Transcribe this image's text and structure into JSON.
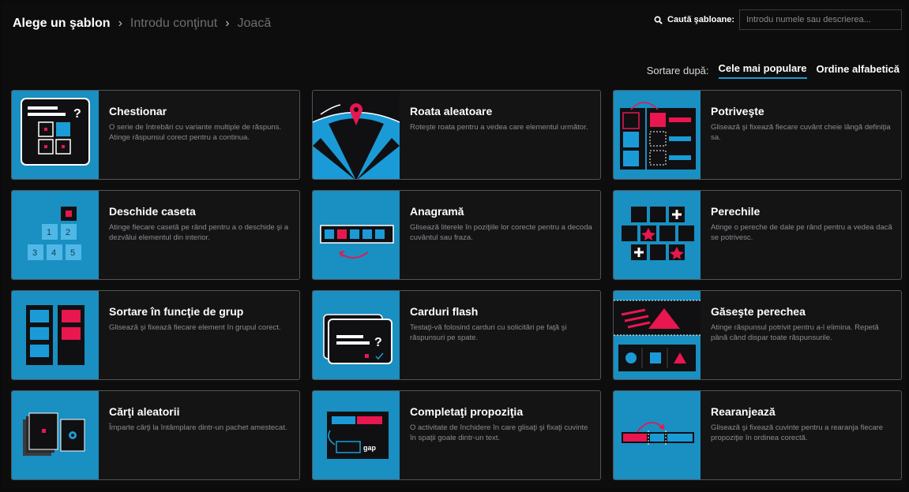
{
  "breadcrumb": {
    "step1": "Alege un şablon",
    "step2": "Introdu conţinut",
    "step3": "Joacă",
    "separator": "›"
  },
  "search": {
    "label": "Caută şabloane:",
    "placeholder": "Introdu numele sau descrierea..."
  },
  "sort": {
    "label": "Sortare după:",
    "options": [
      "Cele mai populare",
      "Ordine alfabetică"
    ],
    "active": "Cele mai populare"
  },
  "colors": {
    "accent_blue": "#1a9bd7",
    "thumb_blue": "#1a8fc1",
    "accent_pink": "#e8174f"
  },
  "templates": [
    {
      "title": "Chestionar",
      "description": "O serie de întrebări cu variante multiple de răspuns. Atinge răspunsul corect pentru a continua.",
      "icon": "quiz-icon"
    },
    {
      "title": "Roata aleatoare",
      "description": "Roteşte roata pentru a vedea care elementul următor.",
      "icon": "wheel-icon"
    },
    {
      "title": "Potriveşte",
      "description": "Glisează şi fixează fiecare cuvânt cheie lângă definiţia sa.",
      "icon": "match-icon"
    },
    {
      "title": "Deschide caseta",
      "description": "Atinge fiecare casetă pe rând pentru a o deschide şi a dezvălui elementul din interior.",
      "icon": "boxes-icon"
    },
    {
      "title": "Anagramă",
      "description": "Glisează literele în poziţiile lor corecte pentru a decoda cuvântul sau fraza.",
      "icon": "anagram-icon"
    },
    {
      "title": "Perechile",
      "description": "Atinge o pereche de dale pe rând pentru a vedea dacă se potrivesc.",
      "icon": "pairs-icon"
    },
    {
      "title": "Sortare în funcţie de grup",
      "description": "Glisează şi fixează fiecare element în grupul corect.",
      "icon": "group-sort-icon"
    },
    {
      "title": "Carduri flash",
      "description": "Testaţi-vă folosind carduri cu solicitări pe faţă şi răspunsuri pe spate.",
      "icon": "flashcards-icon"
    },
    {
      "title": "Găseşte perechea",
      "description": "Atinge răspunsul potrivit pentru a-l elimina. Repetă până când dispar toate răspunsurile.",
      "icon": "find-match-icon"
    },
    {
      "title": "Cărţi aleatorii",
      "description": "Împarte cărţi la întâmplare dintr-un pachet amestecat.",
      "icon": "random-cards-icon"
    },
    {
      "title": "Completaţi propoziţia",
      "description": "O activitate de închidere în care glisaţi şi fixaţi cuvinte în spaţii goale dintr-un text.",
      "icon": "complete-sentence-icon"
    },
    {
      "title": "Rearanjează",
      "description": "Glisează şi fixează cuvinte pentru a rearanja fiecare propoziţie în ordinea corectă.",
      "icon": "rearrange-icon"
    }
  ],
  "thumb_text": {
    "box_numbers": [
      "1",
      "2",
      "3",
      "4",
      "5"
    ],
    "flash_glyph": "?",
    "quiz_glyph": "?",
    "gap_word": "gap"
  }
}
